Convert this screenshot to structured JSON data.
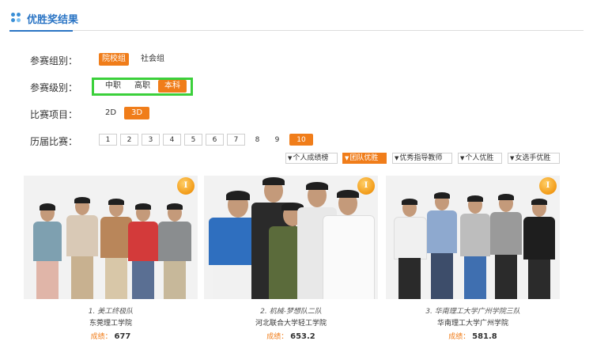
{
  "header": {
    "title": "优胜奖结果"
  },
  "groups": {
    "label": "参赛组别：",
    "options": [
      "院校组",
      "社会组"
    ],
    "active": "院校组"
  },
  "levels": {
    "label": "参赛级别：",
    "options": [
      "中职",
      "高职",
      "本科"
    ],
    "active": "本科"
  },
  "projects": {
    "label": "比赛项目：",
    "options": [
      "2D",
      "3D"
    ],
    "active": "3D"
  },
  "editions": {
    "label": "历届比赛：",
    "pages": [
      "1",
      "2",
      "3",
      "4",
      "5",
      "6",
      "7",
      "8",
      "9",
      "10"
    ],
    "active": "10"
  },
  "filters": {
    "items": [
      "个人成绩榜",
      "团队优胜",
      "优秀指导教师",
      "个人优胜",
      "女选手优胜"
    ],
    "active": "团队优胜"
  },
  "cards": [
    {
      "title": "1. 美工终极队",
      "school": "东莞理工学院",
      "score_label": "成绩：",
      "score": "677",
      "badge": "I"
    },
    {
      "title": "2. 机械-梦想队二队",
      "school": "河北联合大学轻工学院",
      "score_label": "成绩：",
      "score": "653.2",
      "badge": "I"
    },
    {
      "title": "3. 华南理工大学广州学院三队",
      "school": "华南理工大学广州学院",
      "score_label": "成绩：",
      "score": "581.8",
      "badge": "I"
    }
  ],
  "colors": {
    "accent": "#f07d1a",
    "brand": "#2a74c4",
    "highlight": "#3bd03b"
  }
}
